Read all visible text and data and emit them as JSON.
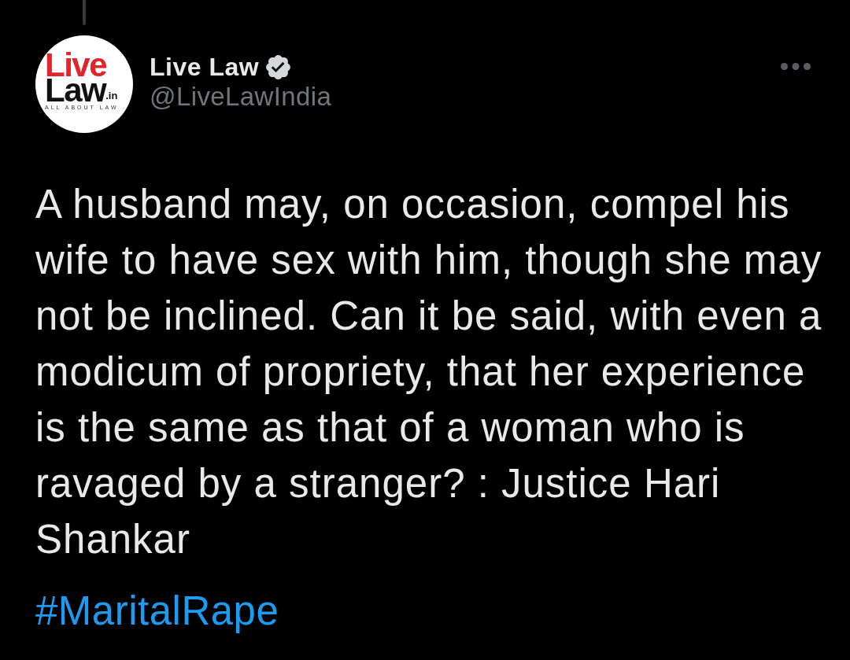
{
  "avatar": {
    "logo_top": "Live",
    "logo_bottom": "Law",
    "logo_suffix": ".in",
    "tagline": "ALL ABOUT LAW"
  },
  "author": {
    "name": "Live Law",
    "verified": true,
    "handle": "@LiveLawIndia"
  },
  "tweet": {
    "text": "A husband may, on occasion, compel his wife to have sex with him, though she may not be inclined. Can it be said, with even a modicum of propriety, that her experience is the same as that of a woman who is ravaged by a stranger? : Justice Hari Shankar",
    "hashtag": "#MaritalRape"
  }
}
